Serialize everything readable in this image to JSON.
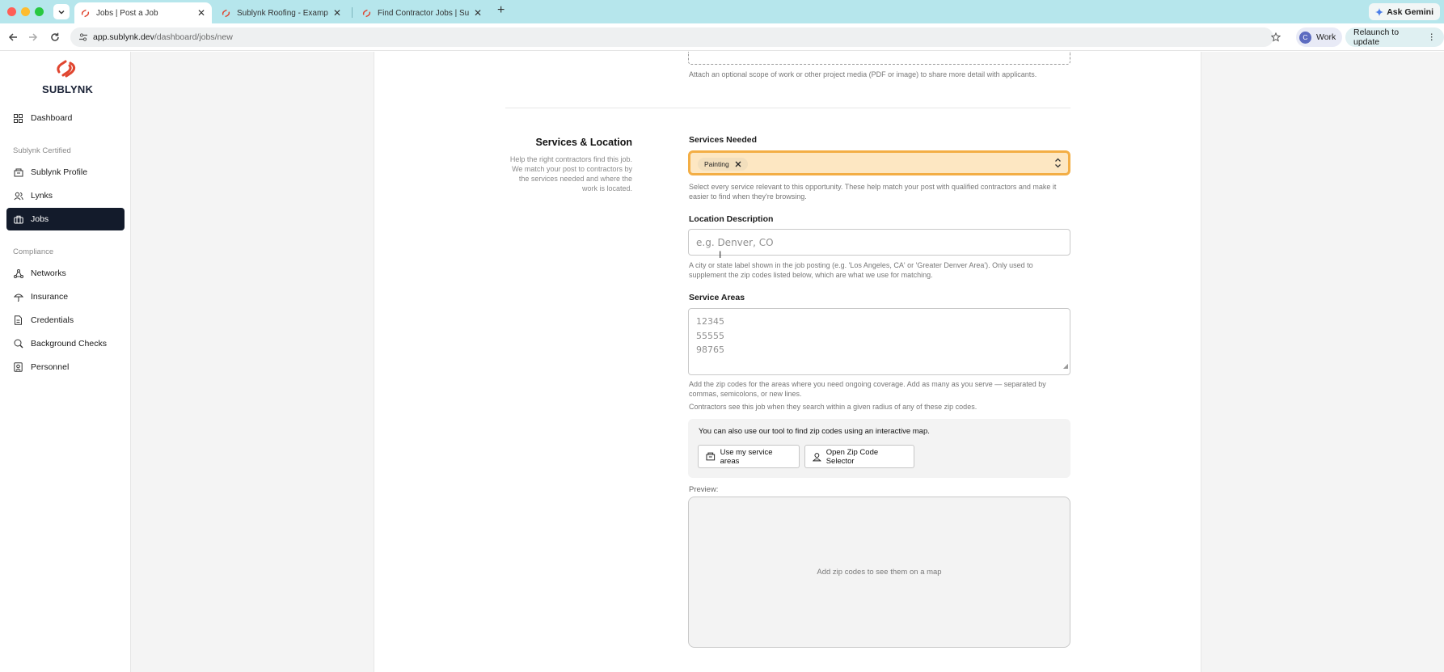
{
  "browser": {
    "tabs": [
      {
        "title": "Jobs | Post a Job",
        "active": true
      },
      {
        "title": "Sublynk Roofing - Example Co",
        "active": false
      },
      {
        "title": "Find Contractor Jobs | Sublynk",
        "active": false
      }
    ],
    "new_tab": "+",
    "ask_gemini": "Ask Gemini",
    "url_host": "app.sublynk.dev",
    "url_path": "/dashboard/jobs/new",
    "profile_initial": "C",
    "profile_name": "Work",
    "relaunch": "Relaunch to update"
  },
  "sidebar": {
    "brand": "SUBLYNK",
    "dashboard": "Dashboard",
    "section_certified": "Sublynk Certified",
    "certified_items": [
      "Sublynk Profile",
      "Lynks",
      "Jobs"
    ],
    "section_compliance": "Compliance",
    "compliance_items": [
      "Networks",
      "Insurance",
      "Credentials",
      "Background Checks",
      "Personnel"
    ],
    "active_item": "Jobs"
  },
  "form": {
    "attach_help": "Attach an optional scope of work or other project media (PDF or image) to share more detail with applicants.",
    "section_title": "Services & Location",
    "section_desc": "Help the right contractors find this job. We match your post to contractors by the services needed and where the work is located.",
    "services": {
      "label": "Services Needed",
      "selected": [
        "Painting"
      ],
      "help": "Select every service relevant to this opportunity. These help match your post with qualified contractors and make it easier to find when they're browsing."
    },
    "location": {
      "label": "Location Description",
      "placeholder": "e.g. Denver, CO",
      "help": "A city or state label shown in the job posting (e.g. 'Los Angeles, CA' or 'Greater Denver Area'). Only used to supplement the zip codes listed below, which are what we use for matching."
    },
    "service_areas": {
      "label": "Service Areas",
      "placeholder": "12345\n55555\n98765",
      "help1": "Add the zip codes for the areas where you need ongoing coverage. Add as many as you serve — separated by commas, semicolons, or new lines.",
      "help2": "Contractors see this job when they search within a given radius of any of these zip codes."
    },
    "tool": {
      "text": "You can also use our tool to find zip codes using an interactive map.",
      "btn_service_areas": "Use my service areas",
      "btn_zip_selector": "Open Zip Code Selector"
    },
    "preview": {
      "label": "Preview:",
      "empty": "Add zip codes to see them on a map"
    }
  },
  "colors": {
    "accent_orange": "#f3ae45",
    "select_bg": "#fde7c2",
    "sidebar_active": "#131b2b",
    "brand_red": "#e0452f"
  }
}
